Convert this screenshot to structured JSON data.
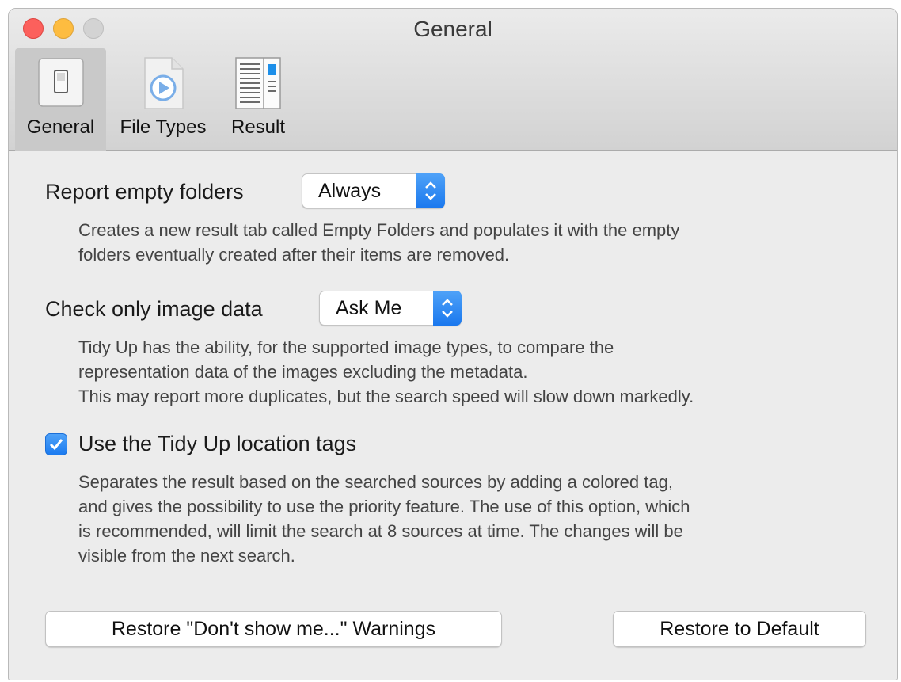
{
  "window": {
    "title": "General"
  },
  "toolbar": {
    "items": [
      {
        "label": "General",
        "icon": "switch-icon",
        "selected": true
      },
      {
        "label": "File Types",
        "icon": "media-file-icon",
        "selected": false
      },
      {
        "label": "Result",
        "icon": "result-layout-icon",
        "selected": false
      }
    ]
  },
  "settings": {
    "report_empty_folders": {
      "label": "Report empty folders",
      "value": "Always",
      "description_lines": [
        "Creates a new result tab called Empty Folders and populates it with the empty",
        "folders eventually created after their items are removed."
      ]
    },
    "check_image_data": {
      "label": "Check only image data",
      "value": "Ask Me",
      "description_lines": [
        "Tidy Up has the ability, for the supported image types, to compare the",
        "representation data of the images excluding the metadata.",
        "This may report more duplicates, but the search speed will slow down markedly."
      ]
    },
    "location_tags": {
      "label": "Use the Tidy Up location tags",
      "checked": true,
      "description_lines": [
        "Separates the result based on the searched sources by adding a colored tag,",
        "and gives the possibility to use the priority feature. The use of this option, which",
        "is recommended, will limit the search at 8 sources at time. The changes will be",
        "visible from the next search."
      ]
    }
  },
  "buttons": {
    "restore_warnings": "Restore \"Don't show me...\" Warnings",
    "restore_default": "Restore to Default"
  },
  "colors": {
    "accent": "#1a78ee",
    "close": "#fc605c",
    "minimize": "#fdbc40",
    "zoom": "#d3d3d3"
  }
}
